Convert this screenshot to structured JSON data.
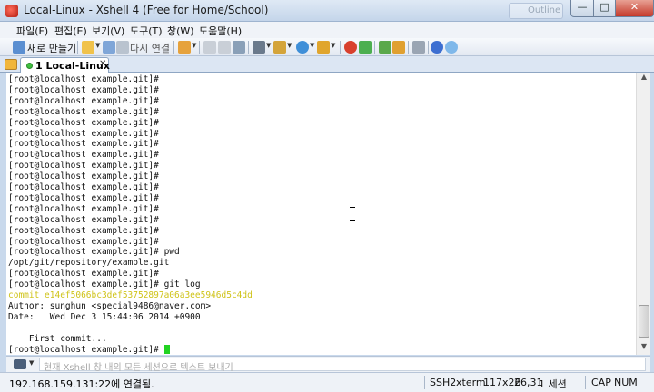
{
  "window": {
    "title": "Local-Linux - Xshell 4 (Free for Home/School)",
    "ghost_tab_label": "Outline"
  },
  "menu": [
    "파일(F)",
    "편집(E)",
    "보기(V)",
    "도구(T)",
    "창(W)",
    "도움말(H)"
  ],
  "toolbar": {
    "new_label": "새로 만들기",
    "reconnect_label": "다시 연결"
  },
  "session_tab": {
    "label": "1 Local-Linux"
  },
  "terminal": {
    "lines": [
      {
        "text": "[root@localhost example.git]#"
      },
      {
        "text": "[root@localhost example.git]#"
      },
      {
        "text": "[root@localhost example.git]#"
      },
      {
        "text": "[root@localhost example.git]#"
      },
      {
        "text": "[root@localhost example.git]#"
      },
      {
        "text": "[root@localhost example.git]#"
      },
      {
        "text": "[root@localhost example.git]#"
      },
      {
        "text": "[root@localhost example.git]#"
      },
      {
        "text": "[root@localhost example.git]#"
      },
      {
        "text": "[root@localhost example.git]#"
      },
      {
        "text": "[root@localhost example.git]#"
      },
      {
        "text": "[root@localhost example.git]#"
      },
      {
        "text": "[root@localhost example.git]#"
      },
      {
        "text": "[root@localhost example.git]#"
      },
      {
        "text": "[root@localhost example.git]#"
      },
      {
        "text": "[root@localhost example.git]#"
      },
      {
        "text": "[root@localhost example.git]# pwd"
      },
      {
        "text": "/opt/git/repository/example.git"
      },
      {
        "text": "[root@localhost example.git]#"
      },
      {
        "text": "[root@localhost example.git]# git log"
      },
      {
        "text": "commit e14ef5066bc3def53752897a06a3ee5946d5c4dd",
        "color": "yellow"
      },
      {
        "text": "Author: sunghun <special9486@naver.com>"
      },
      {
        "text": "Date:   Wed Dec 3 15:44:06 2014 +0900"
      },
      {
        "text": ""
      },
      {
        "text": "    First commit..."
      },
      {
        "text": "[root@localhost example.git]# ",
        "cursor": true
      }
    ]
  },
  "compose": {
    "placeholder": "현재 Xshell 창 내의 모든 세션으로 텍스트 보내기"
  },
  "status": {
    "connection": "192.168.159.131:22에 연결됨.",
    "protocol": "SSH2",
    "terminal_type": "xterm",
    "size": "117x26",
    "cursor_pos": "26,31",
    "sessions": "1 세션",
    "caps": "CAP",
    "num": "NUM"
  },
  "colors": {
    "terminal_bg": "#ffffff",
    "commit_hash": "#cfc318",
    "cursor": "#22d322"
  }
}
